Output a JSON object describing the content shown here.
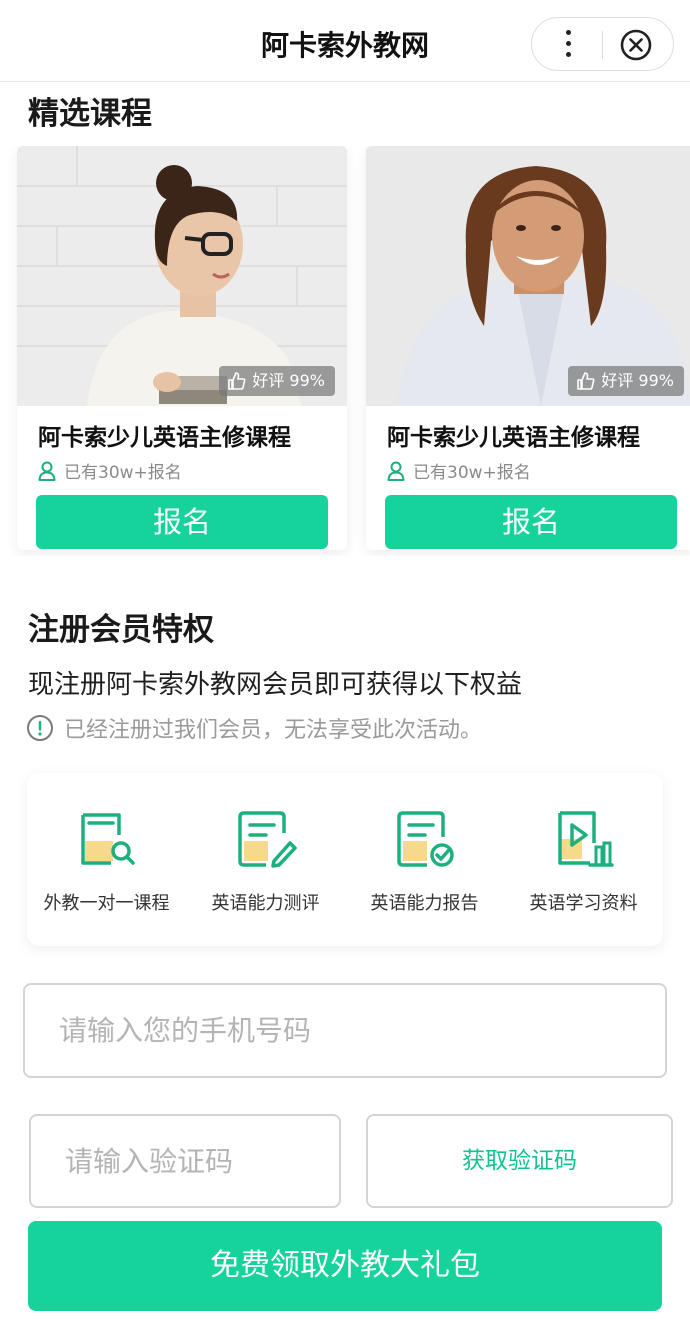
{
  "header": {
    "title": "阿卡索外教网"
  },
  "featured": {
    "heading": "精选课程",
    "courses": [
      {
        "rating": "好评 99%",
        "name": "阿卡索少儿英语主修课程",
        "enrolled": "已有30w+报名",
        "button": "报名"
      },
      {
        "rating": "好评 99%",
        "name": "阿卡索少儿英语主修课程",
        "enrolled": "已有30w+报名",
        "button": "报名"
      }
    ]
  },
  "member": {
    "heading": "注册会员特权",
    "description": "现注册阿卡索外教网会员即可获得以下权益",
    "notice": "已经注册过我们会员，无法享受此次活动。",
    "benefits": [
      {
        "label": "外教一对一课程",
        "icon": "lesson-search-icon"
      },
      {
        "label": "英语能力测评",
        "icon": "assessment-edit-icon"
      },
      {
        "label": "英语能力报告",
        "icon": "report-check-icon"
      },
      {
        "label": "英语学习资料",
        "icon": "video-materials-icon"
      }
    ]
  },
  "form": {
    "phone_placeholder": "请输入您的手机号码",
    "code_placeholder": "请输入验证码",
    "get_code": "获取验证码",
    "submit": "免费领取外教大礼包"
  },
  "colors": {
    "accent": "#16d39b",
    "accent_text": "#12c291",
    "icon_green": "#1bb07e",
    "icon_yellow": "#f6d98a"
  }
}
